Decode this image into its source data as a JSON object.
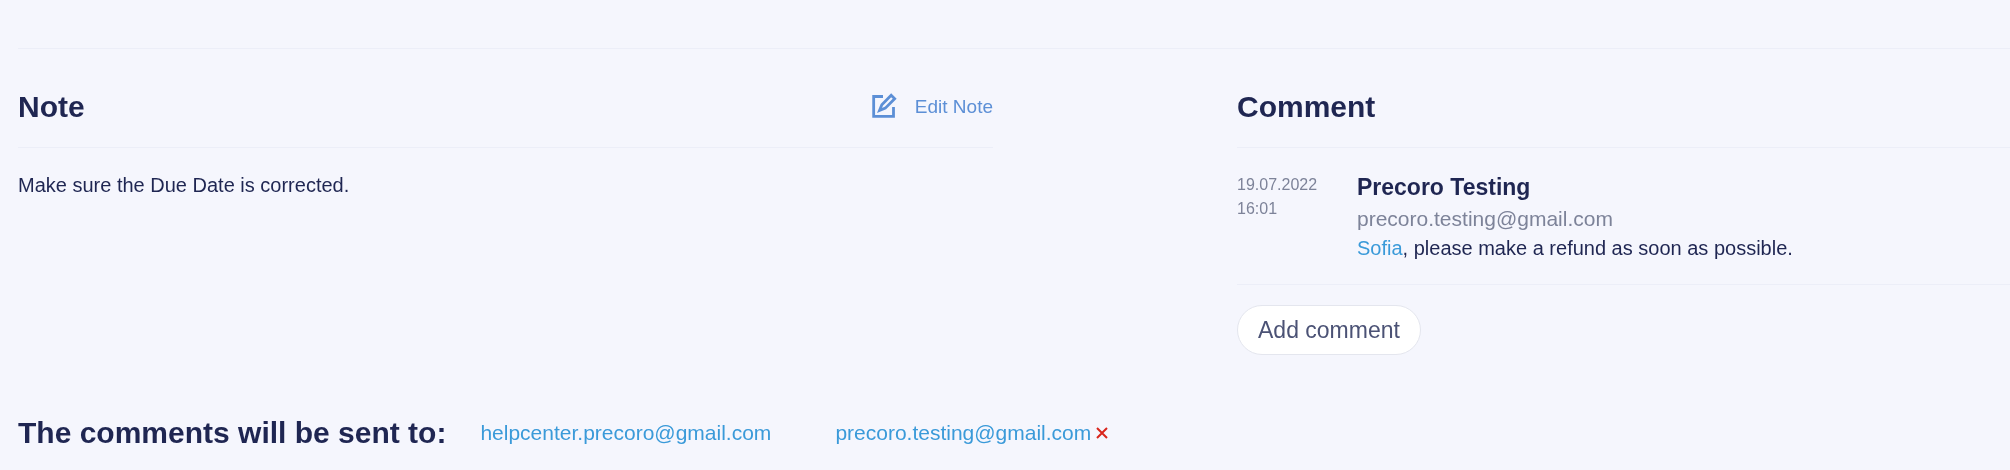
{
  "note": {
    "title": "Note",
    "edit_label": "Edit Note",
    "text": "Make sure the Due Date is corrected."
  },
  "comments": {
    "title": "Comment",
    "items": [
      {
        "date": "19.07.2022",
        "time": "16:01",
        "author": "Precoro Testing",
        "email": "precoro.testing@gmail.com",
        "mention": "Sofia",
        "text": ", please make a refund as soon as possible."
      }
    ],
    "add_label": "Add comment"
  },
  "recipients": {
    "label": "The comments will be sent to:",
    "items": [
      {
        "email": "helpcenter.precoro@gmail.com",
        "removable": false
      },
      {
        "email": "precoro.testing@gmail.com",
        "removable": true
      }
    ]
  }
}
